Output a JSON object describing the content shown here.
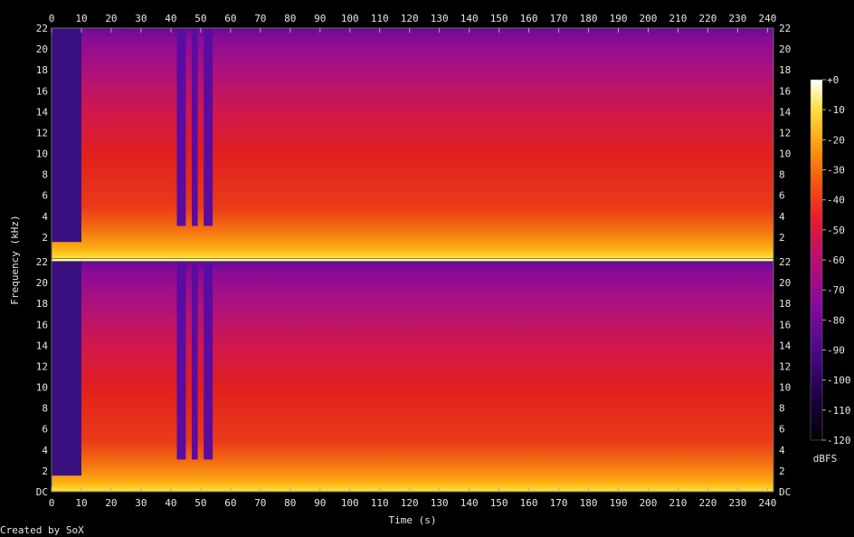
{
  "chart_data": {
    "type": "heatmap",
    "title": "",
    "xlabel": "Time (s)",
    "ylabel": "Frequency (kHz)",
    "x_ticks": [
      "0",
      "10",
      "20",
      "30",
      "40",
      "50",
      "60",
      "70",
      "80",
      "90",
      "100",
      "110",
      "120",
      "130",
      "140",
      "150",
      "160",
      "170",
      "180",
      "190",
      "200",
      "210",
      "220",
      "230",
      "240"
    ],
    "xlim": [
      0,
      242
    ],
    "channels": [
      {
        "name": "",
        "y_ticks": [
          "22",
          "20",
          "18",
          "16",
          "14",
          "12",
          "10",
          "8",
          "6",
          "4",
          "2"
        ],
        "ylim": [
          0,
          22
        ]
      },
      {
        "name": "",
        "y_ticks": [
          "22",
          "20",
          "18",
          "16",
          "14",
          "12",
          "10",
          "8",
          "6",
          "4",
          "2",
          "DC"
        ],
        "ylim": [
          0,
          22
        ]
      }
    ],
    "colorbar": {
      "label": "dBFS",
      "ticks": [
        "+0",
        "-10",
        "-20",
        "-30",
        "-40",
        "-50",
        "-60",
        "-70",
        "-80",
        "-90",
        "-100",
        "-110",
        "-120"
      ],
      "range": [
        -120,
        0
      ],
      "colors": [
        "#000000",
        "#2a0050",
        "#4a0a8a",
        "#8a0aa0",
        "#c0106a",
        "#e81e28",
        "#f55a10",
        "#fb9f10",
        "#fde040",
        "#ffffff"
      ]
    },
    "silent_regions_s": [
      [
        0,
        10
      ],
      [
        42,
        45
      ],
      [
        47,
        49
      ],
      [
        51,
        54
      ]
    ],
    "dominant_band_khz": [
      0,
      5
    ],
    "credit": "Created by SoX"
  }
}
